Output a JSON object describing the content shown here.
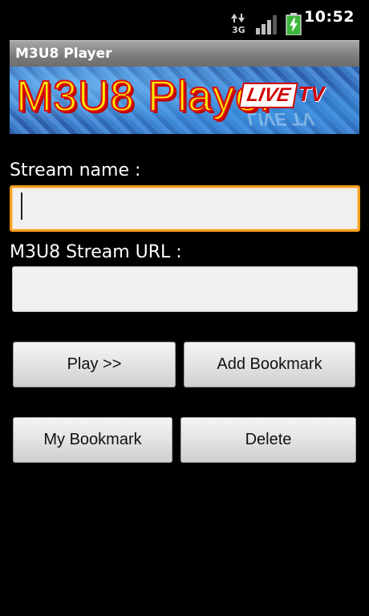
{
  "statusbar": {
    "time": "10:52",
    "network_label": "3G",
    "icons": [
      "network-3g-icon",
      "signal-icon",
      "battery-charging-icon"
    ]
  },
  "titlebar": {
    "title": "M3U8 Player"
  },
  "banner": {
    "title": "M3U8 Player",
    "live": "LIVE",
    "tv": "TV"
  },
  "form": {
    "stream_name_label": "Stream name :",
    "stream_name_value": "",
    "stream_url_label": "M3U8 Stream URL :",
    "stream_url_value": ""
  },
  "buttons": {
    "play": "Play >>",
    "add_bookmark": "Add Bookmark",
    "my_bookmark": "My Bookmark",
    "delete": "Delete"
  },
  "colors": {
    "focus_border": "#f39c1a",
    "title_text": "#ffee00",
    "title_outline": "#e01010"
  }
}
